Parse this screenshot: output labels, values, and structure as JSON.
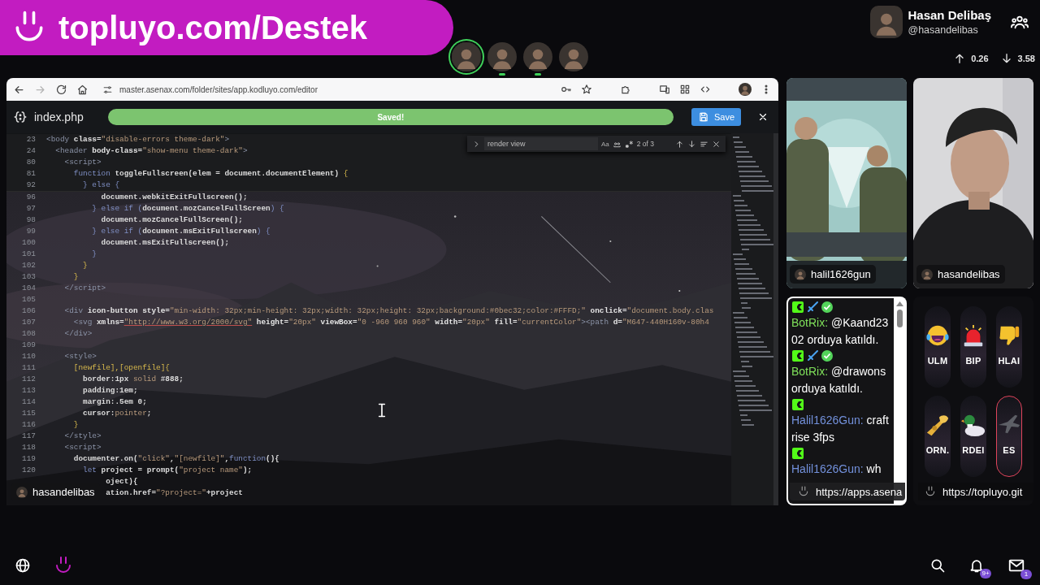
{
  "banner": {
    "text": "topluyo.com/Destek"
  },
  "participants": [
    {
      "speaking": true,
      "mic_active": false
    },
    {
      "speaking": false,
      "mic_active": true
    },
    {
      "speaking": false,
      "mic_active": true
    },
    {
      "speaking": false,
      "mic_active": false
    }
  ],
  "profile": {
    "name": "Hasan Delibaş",
    "handle": "@hasandelibas"
  },
  "stats": {
    "upload": "0.26",
    "download": "3.58"
  },
  "browser": {
    "url": "master.asenax.com/folder/sites/app.kodluyo.com/editor",
    "forward_disabled": true
  },
  "editor": {
    "file": "index.php",
    "status": "Saved!",
    "save_button": "Save",
    "find": {
      "query": "render view",
      "case_toggle": "Aa",
      "result": "2 of 3"
    },
    "sticky_lines": [
      {
        "num": "23",
        "tokens": [
          {
            "kind": "tag",
            "text": "<body "
          },
          {
            "kind": "attr",
            "text": "class="
          },
          {
            "kind": "str",
            "text": "\"disable-errors theme-dark\""
          },
          {
            "kind": "tag",
            "text": ">"
          }
        ]
      },
      {
        "num": "24",
        "tokens": [
          {
            "kind": "tag",
            "text": "  <header "
          },
          {
            "kind": "attr",
            "text": "body-class="
          },
          {
            "kind": "str",
            "text": "\"show-menu theme-dark\""
          },
          {
            "kind": "tag",
            "text": ">"
          }
        ]
      },
      {
        "num": "80",
        "tokens": [
          {
            "kind": "tag",
            "text": "    <script>"
          }
        ]
      },
      {
        "num": "81",
        "tokens": [
          {
            "kind": "kw",
            "text": "      function "
          },
          {
            "kind": "plain",
            "text": "toggleFullscreen(elem = document.documentElement) "
          },
          {
            "kind": "punct",
            "text": "{"
          }
        ]
      },
      {
        "num": "92",
        "tokens": [
          {
            "kind": "kw",
            "text": "        } else {"
          }
        ]
      }
    ],
    "lines": [
      {
        "num": "96",
        "tokens": [
          {
            "kind": "plain",
            "text": "            document.webkitExitFullscreen();"
          }
        ]
      },
      {
        "num": "97",
        "tokens": [
          {
            "kind": "kw",
            "text": "          } else if ("
          },
          {
            "kind": "plain",
            "text": "document.mozCancelFullScreen"
          },
          {
            "kind": "kw",
            "text": ") {"
          }
        ]
      },
      {
        "num": "98",
        "tokens": [
          {
            "kind": "plain",
            "text": "            document.mozCancelFullScreen();"
          }
        ]
      },
      {
        "num": "99",
        "tokens": [
          {
            "kind": "kw",
            "text": "          } else if ("
          },
          {
            "kind": "plain",
            "text": "document.msExitFullscreen"
          },
          {
            "kind": "kw",
            "text": ") {"
          }
        ]
      },
      {
        "num": "100",
        "tokens": [
          {
            "kind": "plain",
            "text": "            document.msExitFullscreen();"
          }
        ]
      },
      {
        "num": "101",
        "tokens": [
          {
            "kind": "kw",
            "text": "          }"
          }
        ]
      },
      {
        "num": "102",
        "tokens": [
          {
            "kind": "punct",
            "text": "        }"
          }
        ]
      },
      {
        "num": "103",
        "tokens": [
          {
            "kind": "punct",
            "text": "      }"
          }
        ]
      },
      {
        "num": "104",
        "tokens": [
          {
            "kind": "tag",
            "text": "    </script>"
          }
        ]
      },
      {
        "num": "105"
      },
      {
        "num": "106",
        "tokens": [
          {
            "kind": "tag",
            "text": "    <div "
          },
          {
            "kind": "attr",
            "text": "icon-button style="
          },
          {
            "kind": "str",
            "text": "\"min-width: 32px;min-height: 32px;width: 32px;height: 32px;background:#0bec32;color:#FFFD;\""
          },
          {
            "kind": "attr",
            "text": " onclick="
          },
          {
            "kind": "str",
            "text": "\"document.body.clas"
          }
        ]
      },
      {
        "num": "107",
        "tokens": [
          {
            "kind": "tag",
            "text": "      <svg "
          },
          {
            "kind": "attr",
            "text": "xmlns="
          },
          {
            "kind": "url",
            "text": "\"http://www.w3.org/2000/svg\""
          },
          {
            "kind": "attr",
            "text": " height="
          },
          {
            "kind": "str",
            "text": "\"20px\""
          },
          {
            "kind": "attr",
            "text": " viewBox="
          },
          {
            "kind": "str",
            "text": "\"0 -960 960 960\""
          },
          {
            "kind": "attr",
            "text": " width="
          },
          {
            "kind": "str",
            "text": "\"20px\""
          },
          {
            "kind": "attr",
            "text": " fill="
          },
          {
            "kind": "str",
            "text": "\"currentColor\""
          },
          {
            "kind": "tag",
            "text": "><path "
          },
          {
            "kind": "attr",
            "text": "d="
          },
          {
            "kind": "str",
            "text": "\"M647-440H160v-80h4"
          }
        ]
      },
      {
        "num": "108",
        "tokens": [
          {
            "kind": "tag",
            "text": "    </div>"
          }
        ]
      },
      {
        "num": "109"
      },
      {
        "num": "110",
        "tokens": [
          {
            "kind": "tag",
            "text": "    <style>"
          }
        ]
      },
      {
        "num": "111",
        "tokens": [
          {
            "kind": "punct",
            "text": "      [newfile],[openfile]{"
          }
        ]
      },
      {
        "num": "112",
        "tokens": [
          {
            "kind": "plain",
            "text": "        border:1px "
          },
          {
            "kind": "str",
            "text": "solid "
          },
          {
            "kind": "plain",
            "text": "#888;"
          }
        ]
      },
      {
        "num": "113",
        "tokens": [
          {
            "kind": "plain",
            "text": "        padding:1em;"
          }
        ]
      },
      {
        "num": "114",
        "tokens": [
          {
            "kind": "plain",
            "text": "        margin:.5em 0;"
          }
        ]
      },
      {
        "num": "115",
        "tokens": [
          {
            "kind": "plain",
            "text": "        cursor:"
          },
          {
            "kind": "str",
            "text": "pointer"
          },
          {
            "kind": "plain",
            "text": ";"
          }
        ]
      },
      {
        "num": "116",
        "tokens": [
          {
            "kind": "punct",
            "text": "      }"
          }
        ]
      },
      {
        "num": "117",
        "tokens": [
          {
            "kind": "tag",
            "text": "    </style>"
          }
        ]
      },
      {
        "num": "118",
        "tokens": [
          {
            "kind": "tag",
            "text": "    <script>"
          }
        ]
      },
      {
        "num": "119",
        "tokens": [
          {
            "kind": "plain",
            "text": "      documenter.on("
          },
          {
            "kind": "str",
            "text": "\"click\""
          },
          {
            "kind": "plain",
            "text": ","
          },
          {
            "kind": "str",
            "text": "\"[newfile]\""
          },
          {
            "kind": "plain",
            "text": ","
          },
          {
            "kind": "kw",
            "text": "function"
          },
          {
            "kind": "plain",
            "text": "(){"
          }
        ]
      },
      {
        "num": "120",
        "tokens": [
          {
            "kind": "kw",
            "text": "        let "
          },
          {
            "kind": "plain",
            "text": "project = prompt("
          },
          {
            "kind": "str",
            "text": "\"project name\""
          },
          {
            "kind": "plain",
            "text": ");"
          }
        ]
      },
      {
        "tokens": [
          {
            "kind": "plain",
            "text": "             oject){"
          }
        ]
      },
      {
        "tokens": [
          {
            "kind": "plain",
            "text": "             ation.href="
          },
          {
            "kind": "str",
            "text": "\"?project=\""
          },
          {
            "kind": "plain",
            "text": "+project"
          }
        ]
      }
    ],
    "presenter": "hasandelibas"
  },
  "tiles": [
    {
      "name": "halil1626gun",
      "kind": "game"
    },
    {
      "name": "hasandelibas",
      "kind": "camera"
    }
  ],
  "chat": {
    "messages": [
      {
        "badges": [
          {
            "kind": "channel"
          },
          {
            "kind": "sword"
          },
          {
            "kind": "verified"
          }
        ],
        "user": "BotRix:",
        "color": "#7fe05a",
        "text": "@Kaand2302 orduya katıldı."
      },
      {
        "badges": [
          {
            "kind": "channel"
          },
          {
            "kind": "sword"
          },
          {
            "kind": "verified"
          }
        ],
        "user": "BotRix:",
        "color": "#7fe05a",
        "text": "@drawons orduya katıldı."
      },
      {
        "badges": [
          {
            "kind": "channel"
          }
        ],
        "user": "Halil1626Gun:",
        "color": "#7391dc",
        "text": "craftrise 3fps"
      },
      {
        "badges": [
          {
            "kind": "channel"
          }
        ],
        "user": "Halil1626Gun:",
        "color": "#7391dc",
        "text": "wh"
      }
    ],
    "link": "https://apps.asena"
  },
  "soundboard": {
    "sounds": [
      {
        "label": "ULM",
        "kind": "laugh",
        "selected": false
      },
      {
        "label": "BIP",
        "kind": "siren",
        "selected": false
      },
      {
        "label": "HLAI",
        "kind": "thumbs-down",
        "selected": false
      },
      {
        "label": "ORN.",
        "kind": "trumpet",
        "selected": false
      },
      {
        "label": "RDEI",
        "kind": "duck",
        "selected": false
      },
      {
        "label": "ES",
        "kind": "jet",
        "selected": true
      }
    ],
    "link": "https://topluyo.git"
  },
  "bottom_bar": {
    "notifications_badge": "9+",
    "messages_badge": "1"
  }
}
